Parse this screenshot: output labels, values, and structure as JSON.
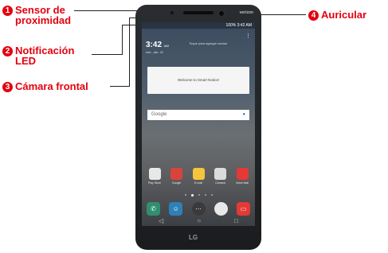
{
  "callouts": [
    {
      "number": "1",
      "label_line1": "Sensor de",
      "label_line2": "proximidad"
    },
    {
      "number": "2",
      "label_line1": "Notificación",
      "label_line2": "LED"
    },
    {
      "number": "3",
      "label_line1": "Cámara frontal"
    },
    {
      "number": "4",
      "label_line1": "Auricular"
    }
  ],
  "accent_color": "#e3000f",
  "phone": {
    "carrier_brand": "verizon",
    "status_text": "100% 3:42 AM",
    "clock_time": "3:42",
    "clock_ampm": "AM",
    "clock_date": "mié., abr. 22",
    "weather_text": "Toque para agregar ciudad",
    "notice_text": "Welcome to Smart Notice!",
    "search_placeholder": "Google",
    "apps": [
      {
        "label": "Play Store",
        "color": "#e8e8e8"
      },
      {
        "label": "Google",
        "color": "#d9443a"
      },
      {
        "label": "E-mail",
        "color": "#f3c53c"
      },
      {
        "label": "Cámara",
        "color": "#dcdcdc"
      },
      {
        "label": "Voice Mail",
        "color": "#e53935"
      }
    ],
    "dock": [
      {
        "icon": "phone-icon",
        "color": "#2f8f6f"
      },
      {
        "icon": "contacts-icon",
        "color": "#2f7fb8"
      },
      {
        "icon": "apps-icon",
        "color": "#3a3a3a"
      },
      {
        "icon": "chrome-icon",
        "color": "#e8e8e8"
      },
      {
        "icon": "messages-icon",
        "color": "#e53935"
      }
    ],
    "brand_logo": "LG"
  }
}
